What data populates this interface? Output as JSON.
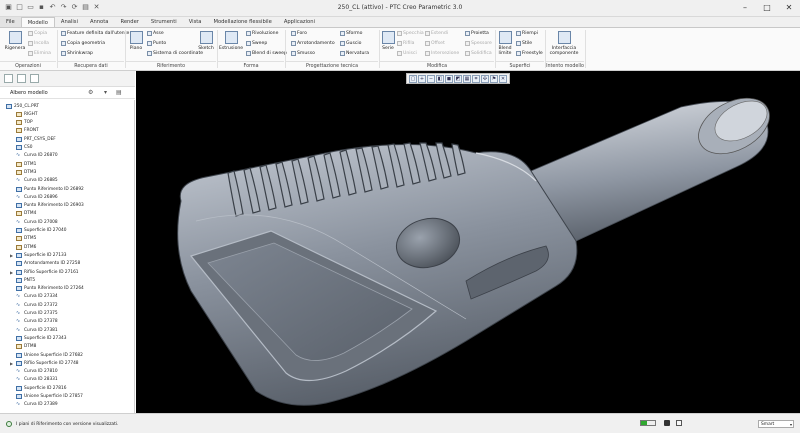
{
  "window": {
    "title": "250_CL (attivo) - PTC Creo Parametric 3.0"
  },
  "tabs": [
    {
      "label": "File",
      "active": false
    },
    {
      "label": "Modello",
      "active": true
    },
    {
      "label": "Analisi",
      "active": false
    },
    {
      "label": "Annota",
      "active": false
    },
    {
      "label": "Render",
      "active": false
    },
    {
      "label": "Strumenti",
      "active": false
    },
    {
      "label": "Vista",
      "active": false
    },
    {
      "label": "Modellazione flessibile",
      "active": false
    },
    {
      "label": "Applicazioni",
      "active": false
    }
  ],
  "ribbon": {
    "operazioni": {
      "label": "Operazioni",
      "big": "Rigenera",
      "items": [
        "Copia",
        "Incolla",
        "Elimina"
      ]
    },
    "recupera": {
      "label": "Recupera dati",
      "items": [
        "Feature definita dall'utente",
        "Copia geometria",
        "Shrinkwrap"
      ]
    },
    "riferimento": {
      "label": "Riferimento",
      "big": "Piano",
      "items": [
        "Asse",
        "Punto",
        "Sistema di coordinate"
      ],
      "sketch": "Sketch"
    },
    "forma": {
      "label": "Forma",
      "big": "Estrusione",
      "items": [
        "Rivoluzione",
        "Sweep",
        "Blend di sweep"
      ]
    },
    "progettazione": {
      "label": "Progettazione tecnica",
      "items": [
        "Foro",
        "Arrotondamento",
        "Smusso",
        "Sformo",
        "Guscio",
        "Nervatura"
      ]
    },
    "modifica": {
      "label": "Modifica",
      "big": "Serie",
      "items": [
        "Specchia",
        "Estendi",
        "Proietta",
        "Rifila",
        "Offset",
        "Spessore",
        "Unisci",
        "Intersezione",
        "Solidifica"
      ]
    },
    "superfici": {
      "label": "Superfici",
      "big": "Blend limite",
      "items": [
        "Riempi",
        "Stile",
        "Freestyle"
      ]
    },
    "intento": {
      "label": "Intento modello",
      "big": "Interfaccia componente"
    }
  },
  "tree": {
    "header": "Albero modello",
    "nodes": [
      {
        "label": "250_CL.PRT",
        "kind": "part",
        "expand": false
      },
      {
        "label": "RIGHT",
        "kind": "plane",
        "expand": false
      },
      {
        "label": "TOP",
        "kind": "plane",
        "expand": false
      },
      {
        "label": "FRONT",
        "kind": "plane",
        "expand": false
      },
      {
        "label": "PRT_CSYS_DEF",
        "kind": "feat",
        "expand": false
      },
      {
        "label": "CS0",
        "kind": "feat",
        "expand": false
      },
      {
        "label": "Curva ID 26870",
        "kind": "curve",
        "expand": false
      },
      {
        "label": "DTM1",
        "kind": "plane",
        "expand": false
      },
      {
        "label": "DTM3",
        "kind": "plane",
        "expand": false
      },
      {
        "label": "Curva ID 26885",
        "kind": "curve",
        "expand": false
      },
      {
        "label": "Punto Riferimento ID 26892",
        "kind": "feat",
        "expand": false
      },
      {
        "label": "Curva ID 26896",
        "kind": "curve",
        "expand": false
      },
      {
        "label": "Punto Riferimento ID 26903",
        "kind": "feat",
        "expand": false
      },
      {
        "label": "DTM4",
        "kind": "plane",
        "expand": false
      },
      {
        "label": "Curva ID 27008",
        "kind": "curve",
        "expand": false
      },
      {
        "label": "Superficie ID 27040",
        "kind": "feat",
        "expand": false
      },
      {
        "label": "DTM5",
        "kind": "plane",
        "expand": false
      },
      {
        "label": "DTM6",
        "kind": "plane",
        "expand": false
      },
      {
        "label": "Superficie ID 27133",
        "kind": "feat",
        "expand": true
      },
      {
        "label": "Arrotondamento ID 27258",
        "kind": "feat",
        "expand": false
      },
      {
        "label": "Riflio Superficie ID 27161",
        "kind": "feat",
        "expand": true
      },
      {
        "label": "PNT5",
        "kind": "feat",
        "expand": false
      },
      {
        "label": "Punto Riferimento ID 27264",
        "kind": "feat",
        "expand": false
      },
      {
        "label": "Curva ID 27334",
        "kind": "curve",
        "expand": false
      },
      {
        "label": "Curva ID 27372",
        "kind": "curve",
        "expand": false
      },
      {
        "label": "Curva ID 27375",
        "kind": "curve",
        "expand": false
      },
      {
        "label": "Curva ID 27378",
        "kind": "curve",
        "expand": false
      },
      {
        "label": "Curva ID 27381",
        "kind": "curve",
        "expand": false
      },
      {
        "label": "Superficie ID 27343",
        "kind": "feat",
        "expand": false
      },
      {
        "label": "DTM8",
        "kind": "plane",
        "expand": false
      },
      {
        "label": "Unione Superficie ID 27682",
        "kind": "feat",
        "expand": false
      },
      {
        "label": "Riflio Superficie ID 27748",
        "kind": "feat",
        "expand": true
      },
      {
        "label": "Curva ID 27810",
        "kind": "curve",
        "expand": false
      },
      {
        "label": "Curva ID 28331",
        "kind": "curve",
        "expand": false
      },
      {
        "label": "Superficie ID 27816",
        "kind": "feat",
        "expand": false
      },
      {
        "label": "Unione Superficie ID 27857",
        "kind": "feat",
        "expand": false
      },
      {
        "label": "Curva ID 27389",
        "kind": "curve",
        "expand": false
      }
    ]
  },
  "status": {
    "message": "I piani di Riferimento con versione visualizzati.",
    "filter": "Smart"
  }
}
